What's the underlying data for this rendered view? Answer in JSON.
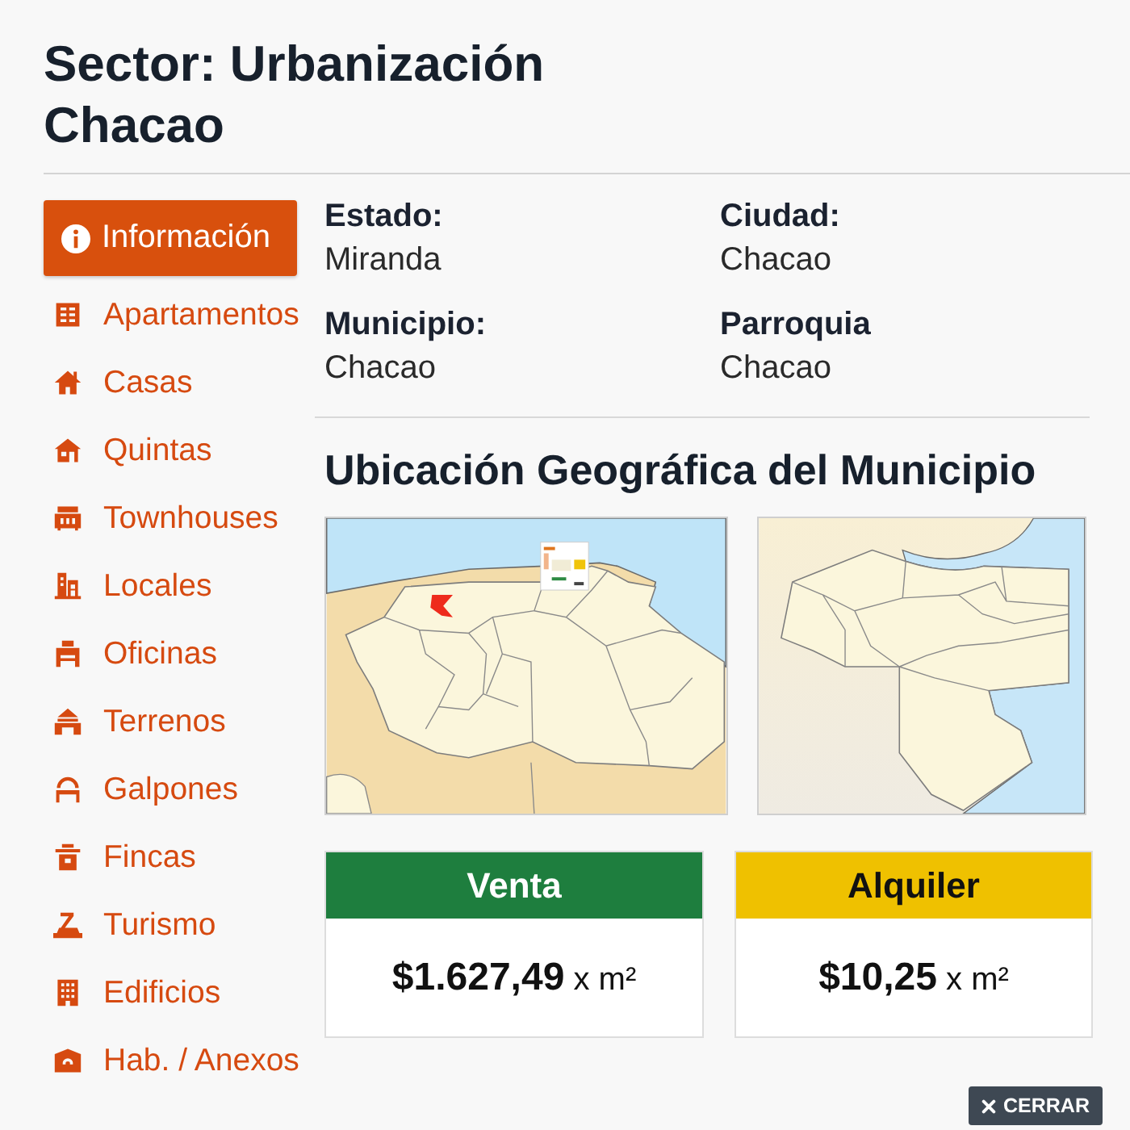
{
  "page": {
    "title": "Sector: Urbanización Chacao"
  },
  "sidebar": {
    "items": [
      {
        "label": "Información",
        "selected": true
      },
      {
        "label": "Apartamentos",
        "selected": false
      },
      {
        "label": "Casas",
        "selected": false
      },
      {
        "label": "Quintas",
        "selected": false
      },
      {
        "label": "Townhouses",
        "selected": false
      },
      {
        "label": "Locales",
        "selected": false
      },
      {
        "label": "Oficinas",
        "selected": false
      },
      {
        "label": "Terrenos",
        "selected": false
      },
      {
        "label": "Galpones",
        "selected": false
      },
      {
        "label": "Fincas",
        "selected": false
      },
      {
        "label": "Turismo",
        "selected": false
      },
      {
        "label": "Edificios",
        "selected": false
      },
      {
        "label": "Hab. / Anexos",
        "selected": false
      }
    ]
  },
  "details": {
    "fields": [
      {
        "label": "Estado:",
        "value": "Miranda"
      },
      {
        "label": "Ciudad:",
        "value": "Chacao"
      },
      {
        "label": "Municipio:",
        "value": "Chacao"
      },
      {
        "label": "Parroquia",
        "value": "Chacao"
      }
    ]
  },
  "location": {
    "title": "Ubicación Geográfica del Municipio"
  },
  "prices": [
    {
      "label": "Venta",
      "amount": "**$1.627,49** x m²",
      "color": "#1e7e3e"
    },
    {
      "label": "Alquiler",
      "amount": "**$10,25** x m²",
      "color": "#efc100"
    }
  ],
  "close_button": {
    "label": "CERRAR"
  }
}
